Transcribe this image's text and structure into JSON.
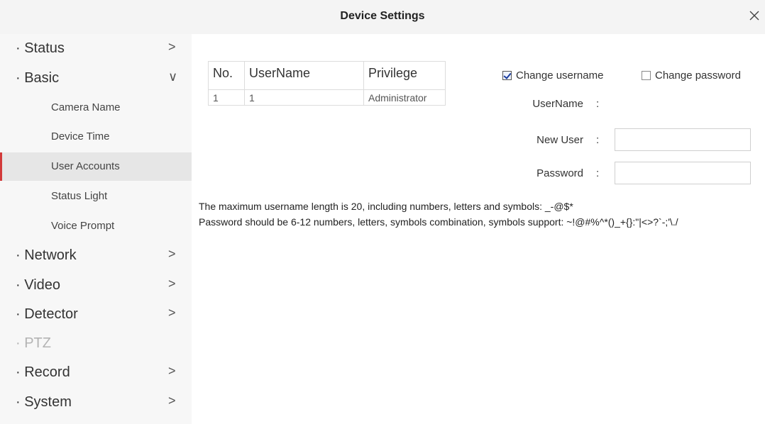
{
  "window": {
    "title": "Device Settings",
    "close_icon": "close-icon"
  },
  "sidebar": {
    "items": [
      {
        "label": "· Status",
        "chevron": ">"
      },
      {
        "label": "· Basic",
        "chevron": "∨"
      },
      {
        "label": "· Network",
        "chevron": ">"
      },
      {
        "label": "· Video",
        "chevron": ">"
      },
      {
        "label": "· Detector",
        "chevron": ">"
      },
      {
        "label": "· PTZ",
        "chevron": ""
      },
      {
        "label": "· Record",
        "chevron": ">"
      },
      {
        "label": "· System",
        "chevron": ">"
      }
    ],
    "basic_subitems": [
      {
        "label": "Camera Name"
      },
      {
        "label": "Device Time"
      },
      {
        "label": "User Accounts"
      },
      {
        "label": "Status Light"
      },
      {
        "label": "Voice Prompt"
      }
    ],
    "active": "User Accounts",
    "accent_color": "#d23a3a"
  },
  "users_table": {
    "headers": [
      "No.",
      "UserName",
      "Privilege"
    ],
    "rows": [
      [
        "1",
        "1",
        "Administrator"
      ]
    ]
  },
  "form": {
    "change_username": {
      "label": "Change username",
      "checked": true
    },
    "change_password": {
      "label": "Change password",
      "checked": false
    },
    "username_label": "UserName",
    "username_value": "",
    "new_user_label": "New User",
    "new_user_value": "",
    "password_label": "Password",
    "password_value": "",
    "colon": ":"
  },
  "hints": {
    "username_rule": "The maximum username length is 20, including numbers, letters and symbols: _-@$*",
    "password_rule": "Password should be 6-12 numbers, letters, symbols combination, symbols support: ~!@#%^*()_+{}:\"|<>?`-;'\\./"
  }
}
